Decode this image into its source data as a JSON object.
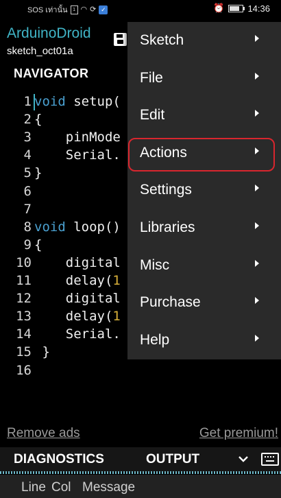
{
  "status_bar": {
    "left_text": "SOS เท่านั้น",
    "time": "14:36"
  },
  "app": {
    "title": "ArduinoDroid",
    "subtitle": "sketch_oct01a",
    "navigator_label": "NAVIGATOR"
  },
  "code": [
    {
      "n": "1",
      "parts": [
        {
          "t": "void",
          "c": "kw"
        },
        {
          "t": " setup(",
          "c": ""
        }
      ]
    },
    {
      "n": "2",
      "parts": [
        {
          "t": "{",
          "c": ""
        }
      ]
    },
    {
      "n": "3",
      "parts": [
        {
          "t": "    pinMode",
          "c": ""
        }
      ]
    },
    {
      "n": "4",
      "parts": [
        {
          "t": "    Serial.",
          "c": ""
        }
      ]
    },
    {
      "n": "5",
      "parts": [
        {
          "t": "}",
          "c": ""
        }
      ]
    },
    {
      "n": "6",
      "parts": []
    },
    {
      "n": "7",
      "parts": []
    },
    {
      "n": "8",
      "parts": [
        {
          "t": "void",
          "c": "kw"
        },
        {
          "t": " loop()",
          "c": ""
        }
      ]
    },
    {
      "n": "9",
      "parts": [
        {
          "t": "{",
          "c": ""
        }
      ]
    },
    {
      "n": "10",
      "parts": [
        {
          "t": "    digital",
          "c": ""
        }
      ]
    },
    {
      "n": "11",
      "parts": [
        {
          "t": "    delay(",
          "c": ""
        },
        {
          "t": "1",
          "c": "num"
        }
      ]
    },
    {
      "n": "12",
      "parts": [
        {
          "t": "    digital",
          "c": ""
        }
      ]
    },
    {
      "n": "13",
      "parts": [
        {
          "t": "    delay(",
          "c": ""
        },
        {
          "t": "1",
          "c": "num"
        }
      ]
    },
    {
      "n": "14",
      "parts": [
        {
          "t": "    Serial.",
          "c": ""
        }
      ]
    },
    {
      "n": "15",
      "parts": [
        {
          "t": " }",
          "c": ""
        }
      ]
    },
    {
      "n": "16",
      "parts": []
    }
  ],
  "links": {
    "remove_ads": "Remove ads",
    "get_premium": "Get premium!"
  },
  "tabs": {
    "diagnostics": "DIAGNOSTICS",
    "output": "OUTPUT"
  },
  "diagnostics_columns": {
    "line": "Line",
    "col": "Col",
    "message": "Message"
  },
  "menu": {
    "items": [
      "Sketch",
      "File",
      "Edit",
      "Actions",
      "Settings",
      "Libraries",
      "Misc",
      "Purchase",
      "Help"
    ],
    "highlighted": "Actions"
  },
  "colors": {
    "accent": "#40b4c6",
    "keyword": "#4aa0d0",
    "number": "#d8b03a",
    "highlight_ring": "#d9262e",
    "menu_bg": "#2a2a2a"
  }
}
